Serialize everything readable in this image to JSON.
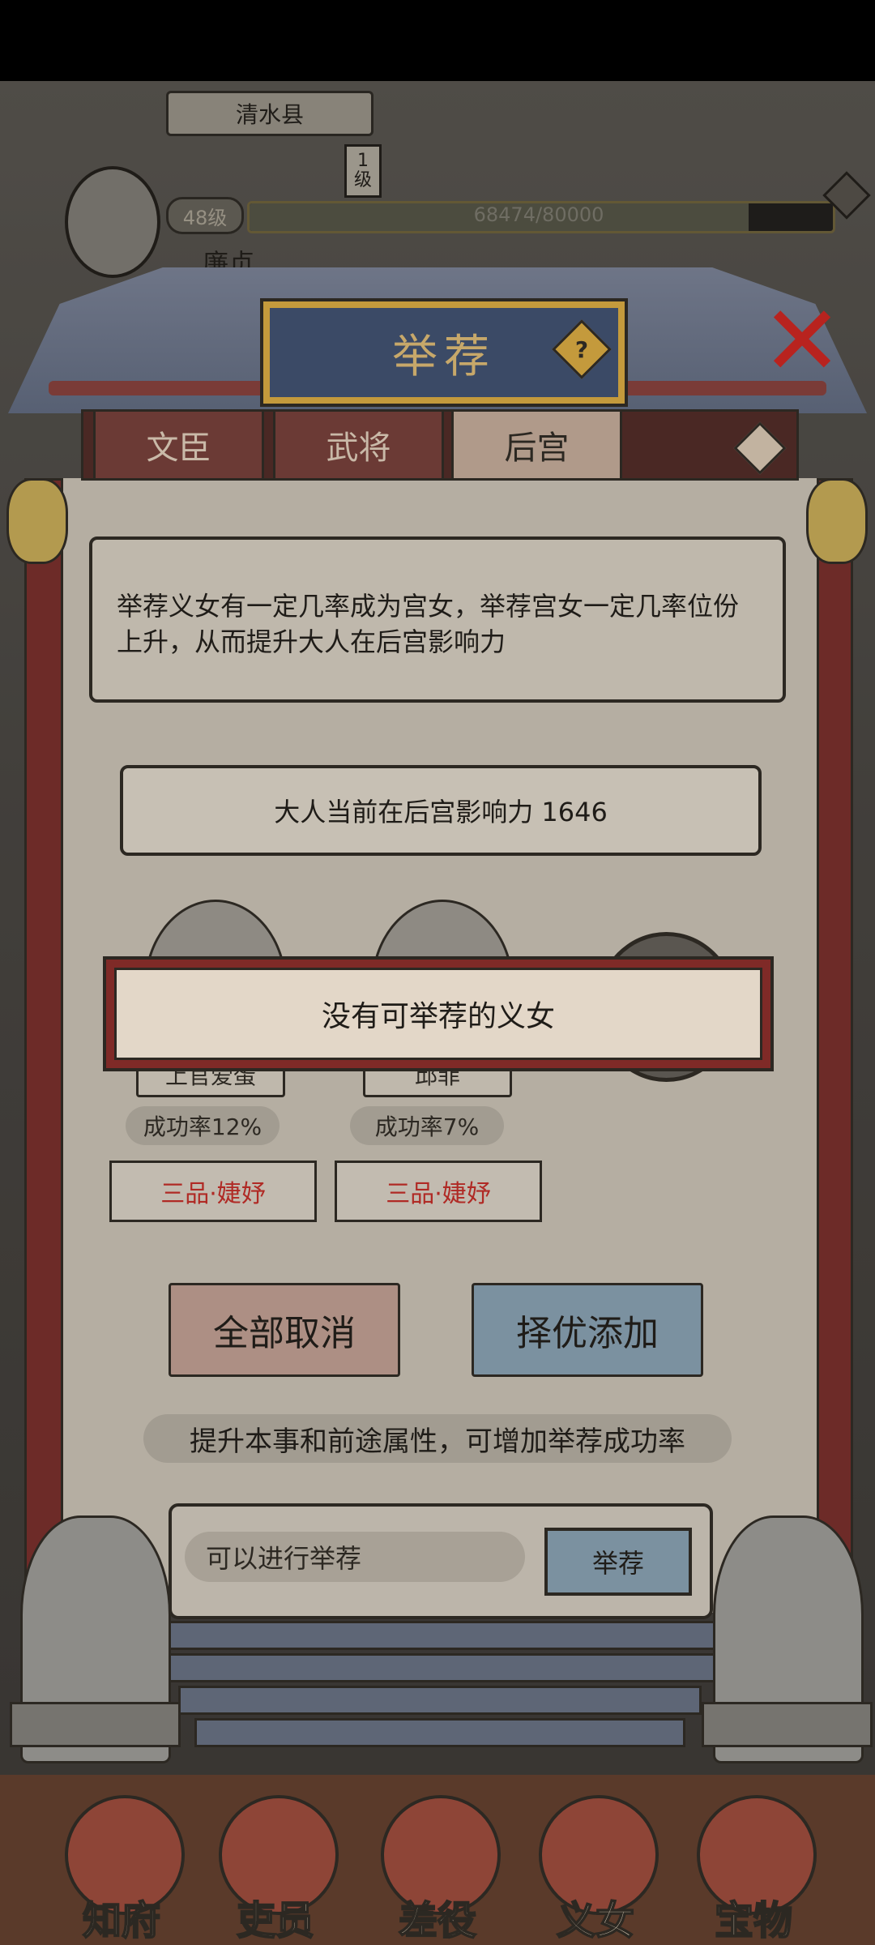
{
  "hud": {
    "county": "清水县",
    "level_badge": "1\n级",
    "rank": "48级",
    "exp": "68474/80000",
    "exp_fraction": 0.856,
    "name": "廉贞"
  },
  "dialog": {
    "title": "举荐",
    "help_symbol": "?",
    "close_symbol": "✕",
    "tabs": [
      {
        "label": "文臣",
        "active": false
      },
      {
        "label": "武将",
        "active": false
      },
      {
        "label": "后宫",
        "active": true
      }
    ],
    "description": "举荐义女有一定几率成为宫女，举荐宫女一定几率位份上升，从而提升大人在后宫影响力",
    "influence": "大人当前在后宫影响力 1646",
    "candidates": [
      {
        "name": "上官爱蛋",
        "rate": "成功率12%",
        "rank": "三品·婕妤"
      },
      {
        "name": "邱菲",
        "rate": "成功率7%",
        "rank": "三品·婕妤"
      }
    ],
    "popup": "没有可举荐的义女",
    "cancel_all": "全部取消",
    "pick_best": "择优添加",
    "hint": "提升本事和前途属性，可增加举荐成功率",
    "status": "可以进行举荐",
    "recommend": "举荐"
  },
  "nav": [
    {
      "label": "知府"
    },
    {
      "label": "吏员"
    },
    {
      "label": "差役"
    },
    {
      "label": "义女"
    },
    {
      "label": "宝物"
    }
  ],
  "colors": {
    "accent_red": "#b02a25",
    "plaque_blue": "#3b4a66",
    "gold": "#c49a3c",
    "button_blue": "#7b91a0"
  }
}
